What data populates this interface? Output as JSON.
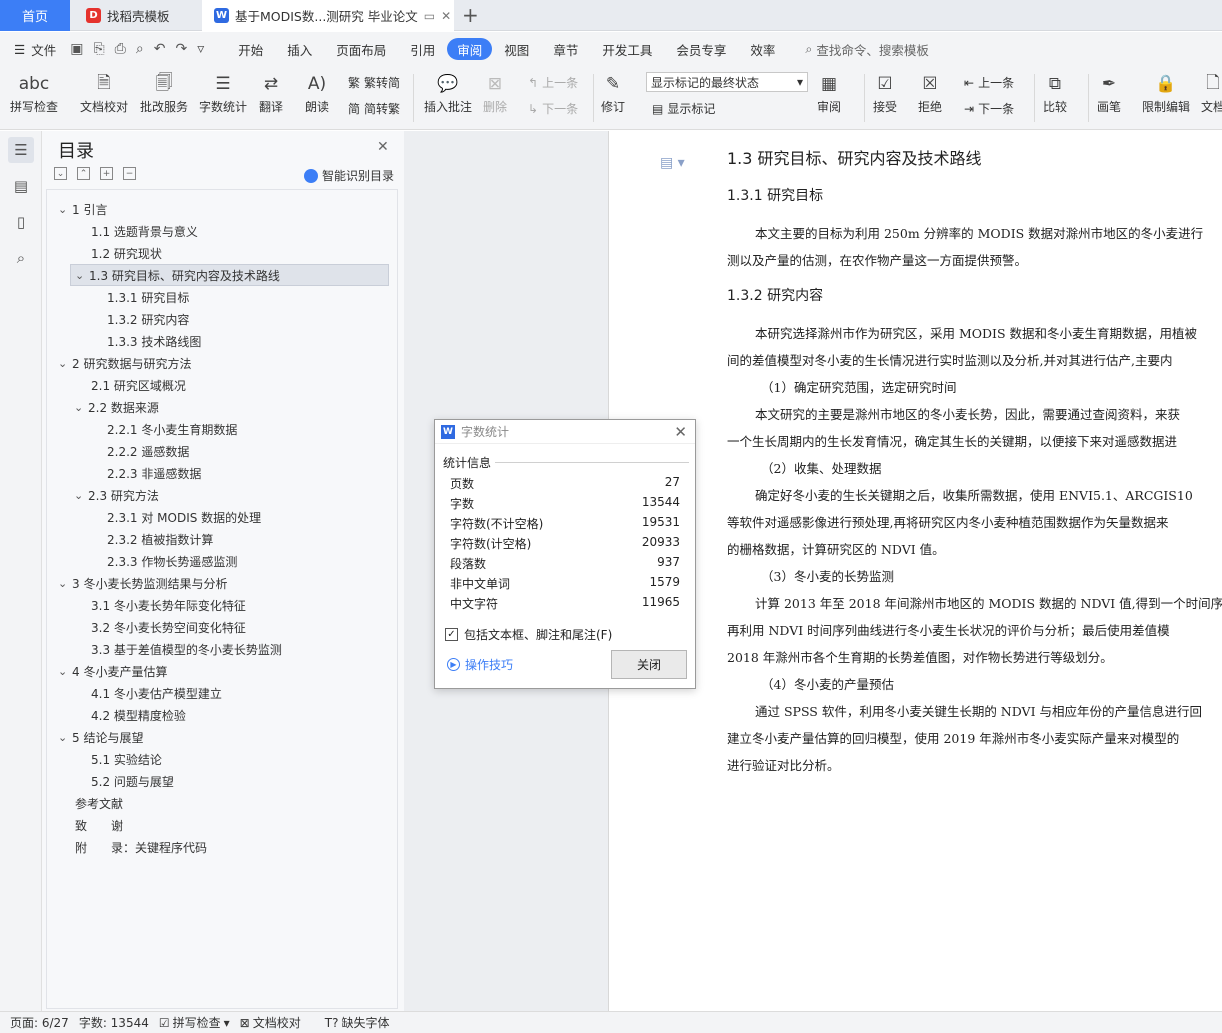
{
  "tabs": {
    "home": "首页",
    "tab1": "找稻壳模板",
    "tab2": "基于MODIS数...测研究 毕业论文"
  },
  "menu": {
    "file": "文件",
    "tabs": [
      "开始",
      "插入",
      "页面布局",
      "引用",
      "审阅",
      "视图",
      "章节",
      "开发工具",
      "会员专享",
      "效率"
    ],
    "active_tab": "审阅",
    "search": "查找命令、搜索模板"
  },
  "ribbon": {
    "spell_check": "拼写检查",
    "doc_proof": "文档校对",
    "batch_service": "批改服务",
    "word_count": "字数统计",
    "translate": "翻译",
    "read_aloud": "朗读",
    "trad_simp": "繁转简",
    "simp_trad": "简转繁",
    "insert_comment": "插入批注",
    "delete": "删除",
    "prev": "上一条",
    "next": "下一条",
    "revise": "修订",
    "markup_state": "显示标记的最终状态",
    "show_markup": "显示标记",
    "review": "审阅",
    "accept": "接受",
    "reject": "拒绝",
    "prev2": "上一条",
    "next2": "下一条",
    "compare": "比较",
    "pen": "画笔",
    "restrict": "限制编辑",
    "doc_more": "文档"
  },
  "toc": {
    "title": "目录",
    "smart": "智能识别目录",
    "items": [
      {
        "t": "1 引言"
      },
      {
        "t": "1.1 选题背景与意义"
      },
      {
        "t": "1.2 研究现状"
      },
      {
        "t": "1.3 研究目标、研究内容及技术路线"
      },
      {
        "t": "1.3.1 研究目标"
      },
      {
        "t": "1.3.2 研究内容"
      },
      {
        "t": "1.3.3 技术路线图"
      },
      {
        "t": "2 研究数据与研究方法"
      },
      {
        "t": "2.1 研究区域概况"
      },
      {
        "t": "2.2 数据来源"
      },
      {
        "t": "2.2.1 冬小麦生育期数据"
      },
      {
        "t": "2.2.2 遥感数据"
      },
      {
        "t": "2.2.3 非遥感数据"
      },
      {
        "t": "2.3 研究方法"
      },
      {
        "t": "2.3.1 对 MODIS 数据的处理"
      },
      {
        "t": "2.3.2 植被指数计算"
      },
      {
        "t": "2.3.3 作物长势遥感监测"
      },
      {
        "t": "3 冬小麦长势监测结果与分析"
      },
      {
        "t": "3.1 冬小麦长势年际变化特征"
      },
      {
        "t": "3.2 冬小麦长势空间变化特征"
      },
      {
        "t": "3.3 基于差值模型的冬小麦长势监测"
      },
      {
        "t": "4 冬小麦产量估算"
      },
      {
        "t": "4.1 冬小麦估产模型建立"
      },
      {
        "t": "4.2 模型精度检验"
      },
      {
        "t": "5 结论与展望"
      },
      {
        "t": "5.1 实验结论"
      },
      {
        "t": "5.2 问题与展望"
      },
      {
        "t": "参考文献"
      },
      {
        "t": "致　　谢"
      },
      {
        "t": "附　　录：关键程序代码"
      }
    ]
  },
  "doc": {
    "h2": "1.3 研究目标、研究内容及技术路线",
    "h3a": "1.3.1 研究目标",
    "p1a": "本文主要的目标为利用 250m 分辨率的 MODIS 数据对滁州市地区的冬小麦进行",
    "p1b": "测以及产量的估测，在农作物产量这一方面提供预警。",
    "h3b": "1.3.2 研究内容",
    "p2a": "本研究选择滁州市作为研究区，采用 MODIS 数据和冬小麦生育期数据，用植被",
    "p2b": "间的差值模型对冬小麦的生长情况进行实时监测以及分析,并对其进行估产,主要内",
    "s1": "（1）确定研究范围，选定研究时间",
    "p3a": "本文研究的主要是滁州市地区的冬小麦长势，因此，需要通过查阅资料，来获",
    "p3b": "一个生长周期内的生长发育情况，确定其生长的关键期，以便接下来对遥感数据进",
    "s2": "（2）收集、处理数据",
    "p4a": "确定好冬小麦的生长关键期之后，收集所需数据，使用 ENVI5.1、ARCGIS10",
    "p4b": "等软件对遥感影像进行预处理,再将研究区内冬小麦种植范围数据作为矢量数据来",
    "p4c": "的栅格数据，计算研究区的 NDVI 值。",
    "s3": "（3）冬小麦的长势监测",
    "p5a": "计算 2013 年至 2018 年间滁州市地区的 MODIS 数据的 NDVI 值,得到一个时间序",
    "p5b": "再利用 NDVI 时间序列曲线进行冬小麦生长状况的评价与分析；最后使用差值模",
    "p5c": "2018 年滁州市各个生育期的长势差值图，对作物长势进行等级划分。",
    "s4": "（4）冬小麦的产量预估",
    "p6a": "通过 SPSS 软件，利用冬小麦关键生长期的 NDVI 与相应年份的产量信息进行回",
    "p6b": "建立冬小麦产量估算的回归模型，使用 2019 年滁州市冬小麦实际产量来对模型的",
    "p6c": "进行验证对比分析。"
  },
  "dialog": {
    "title": "字数统计",
    "section": "统计信息",
    "stats": [
      {
        "label": "页数",
        "value": "27"
      },
      {
        "label": "字数",
        "value": "13544"
      },
      {
        "label": "字符数(不计空格)",
        "value": "19531"
      },
      {
        "label": "字符数(计空格)",
        "value": "20933"
      },
      {
        "label": "段落数",
        "value": "937"
      },
      {
        "label": "非中文单词",
        "value": "1579"
      },
      {
        "label": "中文字符",
        "value": "11965"
      }
    ],
    "checkbox": "包括文本框、脚注和尾注(F)",
    "tips": "操作技巧",
    "close": "关闭"
  },
  "status": {
    "page": "页面: 6/27",
    "words": "字数: 13544",
    "spell": "拼写检查",
    "proof": "文档校对",
    "missing_font": "缺失字体"
  },
  "colors": {
    "accent": "#3c7ef6",
    "wps_red": "#e5322d",
    "wps_blue": "#2f6ae1"
  }
}
